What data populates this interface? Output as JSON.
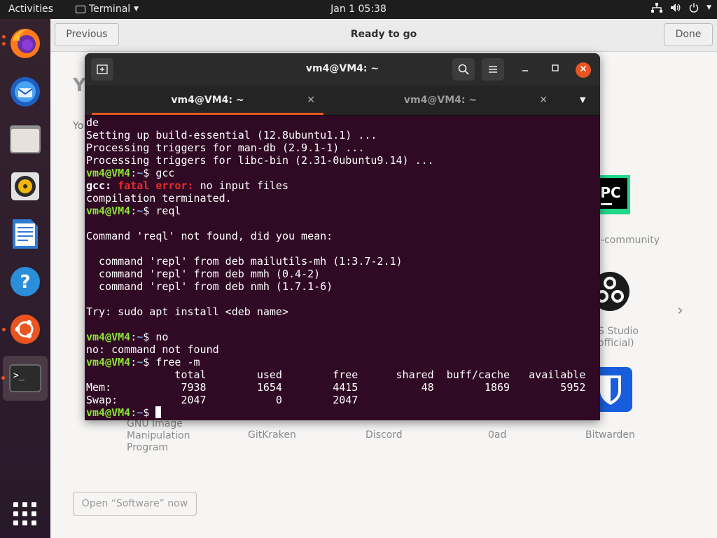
{
  "topbar": {
    "activities": "Activities",
    "app_name": "Terminal",
    "clock": "Jan 1  05:38"
  },
  "dock": {
    "items": [
      "firefox",
      "thunderbird",
      "files",
      "rhythmbox",
      "libreoffice-writer",
      "help",
      "ubuntu-software",
      "terminal"
    ],
    "show_apps": "show-applications"
  },
  "software": {
    "previous": "Previous",
    "title": "Ready to go",
    "done": "Done",
    "heading_fragment": "Y",
    "subtext_fragment": "Yo",
    "pycharm_label": "-community",
    "obs_label_1": "S Studio",
    "obs_label_2": "official)",
    "apps": [
      "GNU Image Manipulation Program",
      "GitKraken",
      "Discord",
      "0ad",
      "Bitwarden"
    ],
    "gimp_line1": "GNU Image",
    "gimp_line2": "Manipulation",
    "gimp_line3": "Program",
    "next_arrow": "›",
    "open_software": "Open “Software” now"
  },
  "terminal": {
    "title": "vm4@VM4: ~",
    "tabs": [
      {
        "label": "vm4@VM4: ~",
        "active": true
      },
      {
        "label": "vm4@VM4: ~",
        "active": false
      }
    ],
    "prompt_user": "vm4@VM4",
    "prompt_path": "~",
    "lines": {
      "l1": "de",
      "l2": "Setting up build-essential (12.8ubuntu1.1) ...",
      "l3": "Processing triggers for man-db (2.9.1-1) ...",
      "l4": "Processing triggers for libc-bin (2.31-0ubuntu9.14) ...",
      "cmd1": "gcc",
      "gcc_prefix": "gcc:",
      "fatal": "fatal error:",
      "gcc_msg": "no input files",
      "terminated": "compilation terminated.",
      "cmd2": "reql",
      "notfound": "Command 'reql' not found, did you mean:",
      "sug1": "  command 'repl' from deb mailutils-mh (1:3.7-2.1)",
      "sug2": "  command 'repl' from deb mmh (0.4-2)",
      "sug3": "  command 'repl' from deb nmh (1.7.1-6)",
      "try": "Try: sudo apt install <deb name>",
      "cmd3": "no",
      "no_notfound": "no: command not found",
      "cmd4": "free -m",
      "free_header": "              total        used        free      shared  buff/cache   available",
      "free_mem": "Mem:           7938        1654        4415          48        1869        5952",
      "free_swap": "Swap:          2047           0        2047"
    }
  },
  "colors": {
    "terminal_bg": "#300a24",
    "prompt_user": "#8ae234",
    "prompt_path": "#729fcf",
    "error": "#ef2929",
    "accent": "#e95420"
  }
}
